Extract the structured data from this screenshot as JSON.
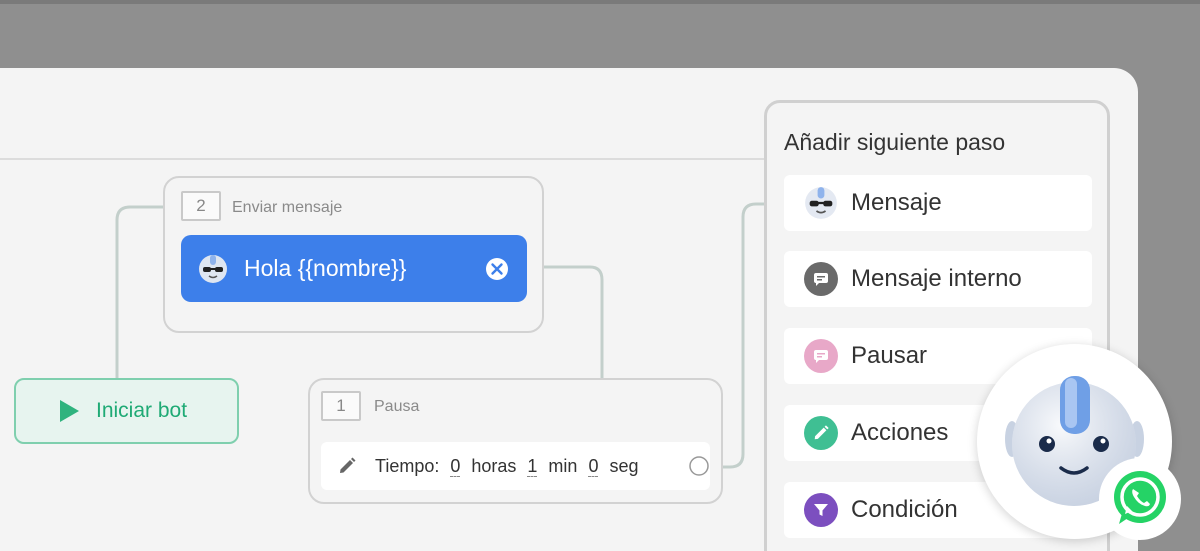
{
  "flow": {
    "start_button_label": "Iniciar bot",
    "message_node": {
      "step_number": "2",
      "title": "Enviar mensaje",
      "message_text": "Hola {{nombre}}"
    },
    "pause_node": {
      "step_number": "1",
      "title": "Pausa",
      "time_label": "Tiempo:",
      "hours_value": "0",
      "hours_unit": "horas",
      "minutes_value": "1",
      "minutes_unit": "min",
      "seconds_value": "0",
      "seconds_unit": "seg"
    }
  },
  "next_step_panel": {
    "title": "Añadir siguiente paso",
    "options": [
      {
        "label": "Mensaje",
        "icon": "bot-avatar-icon"
      },
      {
        "label": "Mensaje interno",
        "icon": "chat-bubble-icon",
        "color": "#666666"
      },
      {
        "label": "Pausar",
        "icon": "chat-bubble-icon",
        "color": "#e7a4c6"
      },
      {
        "label": "Acciones",
        "icon": "pencil-icon",
        "color": "#3fbf93"
      },
      {
        "label": "Condición",
        "icon": "filter-icon",
        "color": "#7c4fbf"
      }
    ]
  },
  "colors": {
    "accent_blue": "#3d7fea",
    "start_green": "#1faa75",
    "whatsapp_green": "#25d366"
  }
}
